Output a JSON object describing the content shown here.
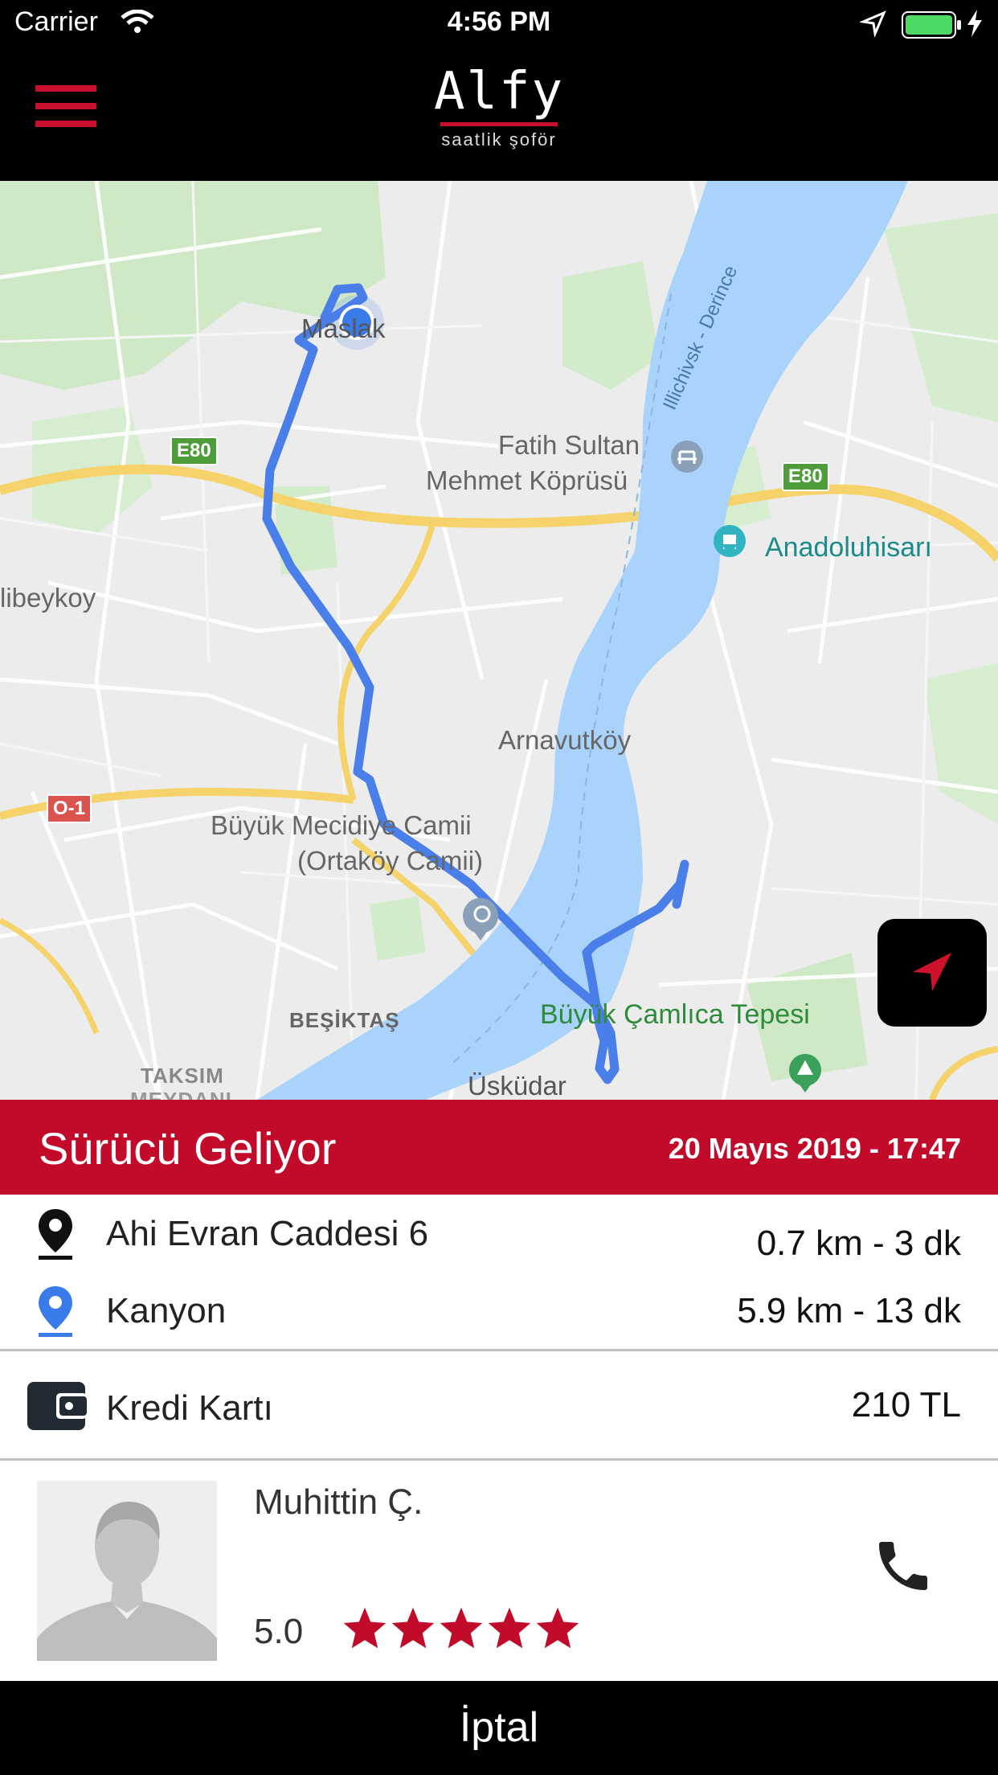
{
  "status_bar": {
    "carrier": "Carrier",
    "time": "4:56 PM"
  },
  "header": {
    "logo": "Alfy",
    "tagline": "saatlik şoför"
  },
  "map": {
    "labels": {
      "maslak": "Maslak",
      "bridge_line1": "Fatih Sultan",
      "bridge_line2": "Mehmet Köprüsü",
      "anadoluhisari": "Anadoluhisarı",
      "alibeykoy": "libeykoy",
      "arnavutkoy": "Arnavutköy",
      "mosque_line1": "Büyük Mecidiye Camii",
      "mosque_line2": "(Ortaköy Camii)",
      "besiktas": "BEŞİKTAŞ",
      "taksim": "TAKSIM",
      "meydani": "MEYDANI",
      "uskudar": "Üsküdar",
      "camlica": "Büyük Çamlıca Tepesi",
      "ferry": "Illichivsk - Derince",
      "e80_left": "E80",
      "e80_right": "E80",
      "o1": "O-1"
    }
  },
  "banner": {
    "title": "Sürücü Geliyor",
    "date": "20 Mayıs 2019 - 17:47"
  },
  "trip": {
    "pickup": {
      "address": "Ahi Evran Caddesi 6",
      "eta": "0.7 km - 3 dk"
    },
    "destination": {
      "address": "Kanyon",
      "eta": "5.9 km - 13 dk"
    }
  },
  "payment": {
    "method": "Kredi Kartı",
    "amount": "210 TL"
  },
  "driver": {
    "name": "Muhittin Ç.",
    "rating": "5.0",
    "stars": 5
  },
  "actions": {
    "cancel_label": "İptal"
  },
  "colors": {
    "brand_red": "#c20a2b",
    "route_blue": "#4a7ee8",
    "water": "#a9d3fb"
  }
}
